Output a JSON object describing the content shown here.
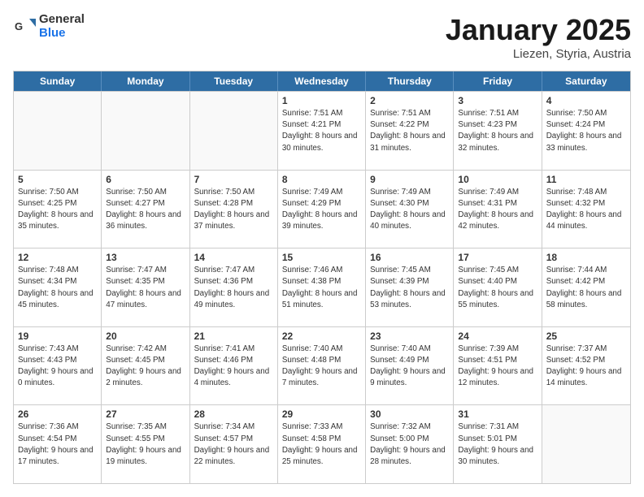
{
  "header": {
    "logo_general": "General",
    "logo_blue": "Blue",
    "month": "January 2025",
    "location": "Liezen, Styria, Austria"
  },
  "weekdays": [
    "Sunday",
    "Monday",
    "Tuesday",
    "Wednesday",
    "Thursday",
    "Friday",
    "Saturday"
  ],
  "weeks": [
    [
      {
        "day": "",
        "info": ""
      },
      {
        "day": "",
        "info": ""
      },
      {
        "day": "",
        "info": ""
      },
      {
        "day": "1",
        "info": "Sunrise: 7:51 AM\nSunset: 4:21 PM\nDaylight: 8 hours\nand 30 minutes."
      },
      {
        "day": "2",
        "info": "Sunrise: 7:51 AM\nSunset: 4:22 PM\nDaylight: 8 hours\nand 31 minutes."
      },
      {
        "day": "3",
        "info": "Sunrise: 7:51 AM\nSunset: 4:23 PM\nDaylight: 8 hours\nand 32 minutes."
      },
      {
        "day": "4",
        "info": "Sunrise: 7:50 AM\nSunset: 4:24 PM\nDaylight: 8 hours\nand 33 minutes."
      }
    ],
    [
      {
        "day": "5",
        "info": "Sunrise: 7:50 AM\nSunset: 4:25 PM\nDaylight: 8 hours\nand 35 minutes."
      },
      {
        "day": "6",
        "info": "Sunrise: 7:50 AM\nSunset: 4:27 PM\nDaylight: 8 hours\nand 36 minutes."
      },
      {
        "day": "7",
        "info": "Sunrise: 7:50 AM\nSunset: 4:28 PM\nDaylight: 8 hours\nand 37 minutes."
      },
      {
        "day": "8",
        "info": "Sunrise: 7:49 AM\nSunset: 4:29 PM\nDaylight: 8 hours\nand 39 minutes."
      },
      {
        "day": "9",
        "info": "Sunrise: 7:49 AM\nSunset: 4:30 PM\nDaylight: 8 hours\nand 40 minutes."
      },
      {
        "day": "10",
        "info": "Sunrise: 7:49 AM\nSunset: 4:31 PM\nDaylight: 8 hours\nand 42 minutes."
      },
      {
        "day": "11",
        "info": "Sunrise: 7:48 AM\nSunset: 4:32 PM\nDaylight: 8 hours\nand 44 minutes."
      }
    ],
    [
      {
        "day": "12",
        "info": "Sunrise: 7:48 AM\nSunset: 4:34 PM\nDaylight: 8 hours\nand 45 minutes."
      },
      {
        "day": "13",
        "info": "Sunrise: 7:47 AM\nSunset: 4:35 PM\nDaylight: 8 hours\nand 47 minutes."
      },
      {
        "day": "14",
        "info": "Sunrise: 7:47 AM\nSunset: 4:36 PM\nDaylight: 8 hours\nand 49 minutes."
      },
      {
        "day": "15",
        "info": "Sunrise: 7:46 AM\nSunset: 4:38 PM\nDaylight: 8 hours\nand 51 minutes."
      },
      {
        "day": "16",
        "info": "Sunrise: 7:45 AM\nSunset: 4:39 PM\nDaylight: 8 hours\nand 53 minutes."
      },
      {
        "day": "17",
        "info": "Sunrise: 7:45 AM\nSunset: 4:40 PM\nDaylight: 8 hours\nand 55 minutes."
      },
      {
        "day": "18",
        "info": "Sunrise: 7:44 AM\nSunset: 4:42 PM\nDaylight: 8 hours\nand 58 minutes."
      }
    ],
    [
      {
        "day": "19",
        "info": "Sunrise: 7:43 AM\nSunset: 4:43 PM\nDaylight: 9 hours\nand 0 minutes."
      },
      {
        "day": "20",
        "info": "Sunrise: 7:42 AM\nSunset: 4:45 PM\nDaylight: 9 hours\nand 2 minutes."
      },
      {
        "day": "21",
        "info": "Sunrise: 7:41 AM\nSunset: 4:46 PM\nDaylight: 9 hours\nand 4 minutes."
      },
      {
        "day": "22",
        "info": "Sunrise: 7:40 AM\nSunset: 4:48 PM\nDaylight: 9 hours\nand 7 minutes."
      },
      {
        "day": "23",
        "info": "Sunrise: 7:40 AM\nSunset: 4:49 PM\nDaylight: 9 hours\nand 9 minutes."
      },
      {
        "day": "24",
        "info": "Sunrise: 7:39 AM\nSunset: 4:51 PM\nDaylight: 9 hours\nand 12 minutes."
      },
      {
        "day": "25",
        "info": "Sunrise: 7:37 AM\nSunset: 4:52 PM\nDaylight: 9 hours\nand 14 minutes."
      }
    ],
    [
      {
        "day": "26",
        "info": "Sunrise: 7:36 AM\nSunset: 4:54 PM\nDaylight: 9 hours\nand 17 minutes."
      },
      {
        "day": "27",
        "info": "Sunrise: 7:35 AM\nSunset: 4:55 PM\nDaylight: 9 hours\nand 19 minutes."
      },
      {
        "day": "28",
        "info": "Sunrise: 7:34 AM\nSunset: 4:57 PM\nDaylight: 9 hours\nand 22 minutes."
      },
      {
        "day": "29",
        "info": "Sunrise: 7:33 AM\nSunset: 4:58 PM\nDaylight: 9 hours\nand 25 minutes."
      },
      {
        "day": "30",
        "info": "Sunrise: 7:32 AM\nSunset: 5:00 PM\nDaylight: 9 hours\nand 28 minutes."
      },
      {
        "day": "31",
        "info": "Sunrise: 7:31 AM\nSunset: 5:01 PM\nDaylight: 9 hours\nand 30 minutes."
      },
      {
        "day": "",
        "info": ""
      }
    ]
  ]
}
